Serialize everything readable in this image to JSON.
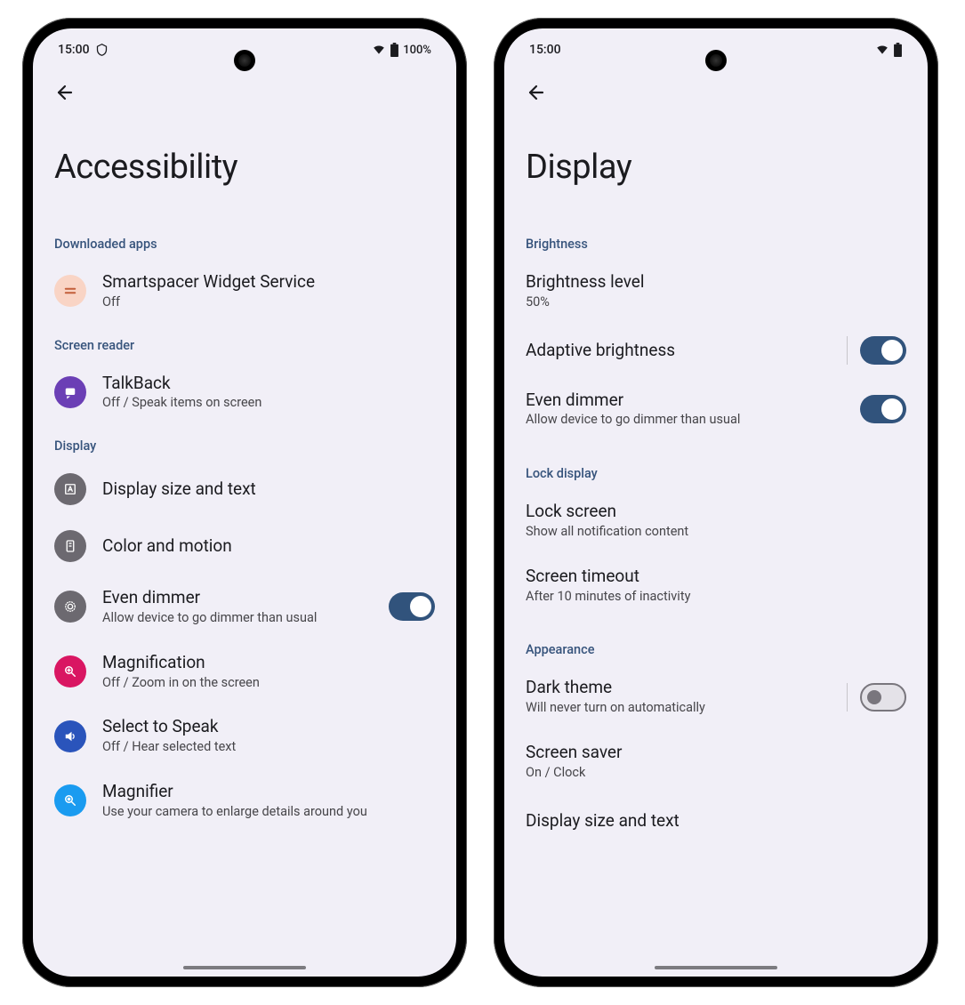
{
  "colors": {
    "accent": "#31537c",
    "header": "#37547c",
    "bg": "#f1eff7"
  },
  "left": {
    "status": {
      "time": "15:00",
      "battery": "100%"
    },
    "title": "Accessibility",
    "sections": [
      {
        "header": "Downloaded apps",
        "items": [
          {
            "icon_bg": "#f9d4c5",
            "icon_name": "list-icon",
            "title": "Smartspacer Widget Service",
            "sub": "Off"
          }
        ]
      },
      {
        "header": "Screen reader",
        "items": [
          {
            "icon_bg": "#6b3fb5",
            "icon_name": "talkback-icon",
            "title": "TalkBack",
            "sub": "Off / Speak items on screen"
          }
        ]
      },
      {
        "header": "Display",
        "items": [
          {
            "icon_bg": "#6c6970",
            "icon_name": "text-size-icon",
            "title": "Display size and text"
          },
          {
            "icon_bg": "#6c6970",
            "icon_name": "color-motion-icon",
            "title": "Color and motion"
          },
          {
            "icon_bg": "#6c6970",
            "icon_name": "dimmer-icon",
            "title": "Even dimmer",
            "sub": "Allow device to go dimmer than usual",
            "toggle": true,
            "toggle_on": true
          },
          {
            "icon_bg": "#d91662",
            "icon_name": "magnification-icon",
            "title": "Magnification",
            "sub": "Off / Zoom in on the screen"
          },
          {
            "icon_bg": "#2a54bb",
            "icon_name": "select-speak-icon",
            "title": "Select to Speak",
            "sub": "Off / Hear selected text"
          },
          {
            "icon_bg": "#1a9bf0",
            "icon_name": "magnifier-icon",
            "title": "Magnifier",
            "sub": "Use your camera to enlarge details around you"
          }
        ]
      }
    ]
  },
  "right": {
    "status": {
      "time": "15:00"
    },
    "title": "Display",
    "sections": [
      {
        "header": "Brightness",
        "items": [
          {
            "title": "Brightness level",
            "sub": "50%"
          },
          {
            "title": "Adaptive brightness",
            "toggle": true,
            "toggle_on": true,
            "has_separator": true
          },
          {
            "title": "Even dimmer",
            "sub": "Allow device to go dimmer than usual",
            "toggle": true,
            "toggle_on": true
          }
        ]
      },
      {
        "header": "Lock display",
        "items": [
          {
            "title": "Lock screen",
            "sub": "Show all notification content"
          },
          {
            "title": "Screen timeout",
            "sub": "After 10 minutes of inactivity"
          }
        ]
      },
      {
        "header": "Appearance",
        "items": [
          {
            "title": "Dark theme",
            "sub": "Will never turn on automatically",
            "toggle": true,
            "toggle_on": false,
            "has_separator": true
          },
          {
            "title": "Screen saver",
            "sub": "On / Clock"
          },
          {
            "title": "Display size and text"
          }
        ]
      }
    ]
  }
}
